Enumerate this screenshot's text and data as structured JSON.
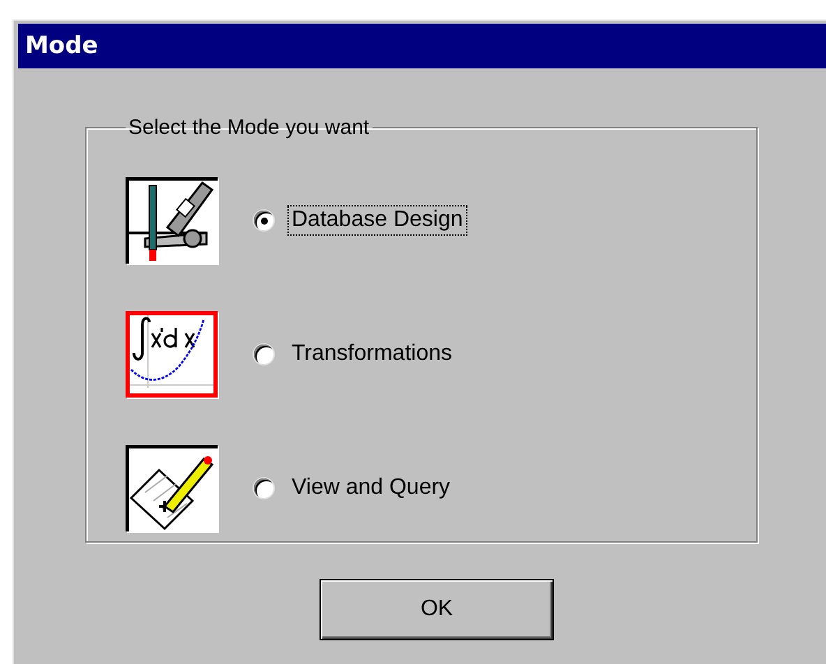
{
  "window": {
    "title": "Mode"
  },
  "group": {
    "label": "Select the Mode you want"
  },
  "options": [
    {
      "label": "Database Design",
      "selected": true
    },
    {
      "label": "Transformations",
      "selected": false
    },
    {
      "label": "View and Query",
      "selected": false
    }
  ],
  "buttons": [
    "OK"
  ]
}
